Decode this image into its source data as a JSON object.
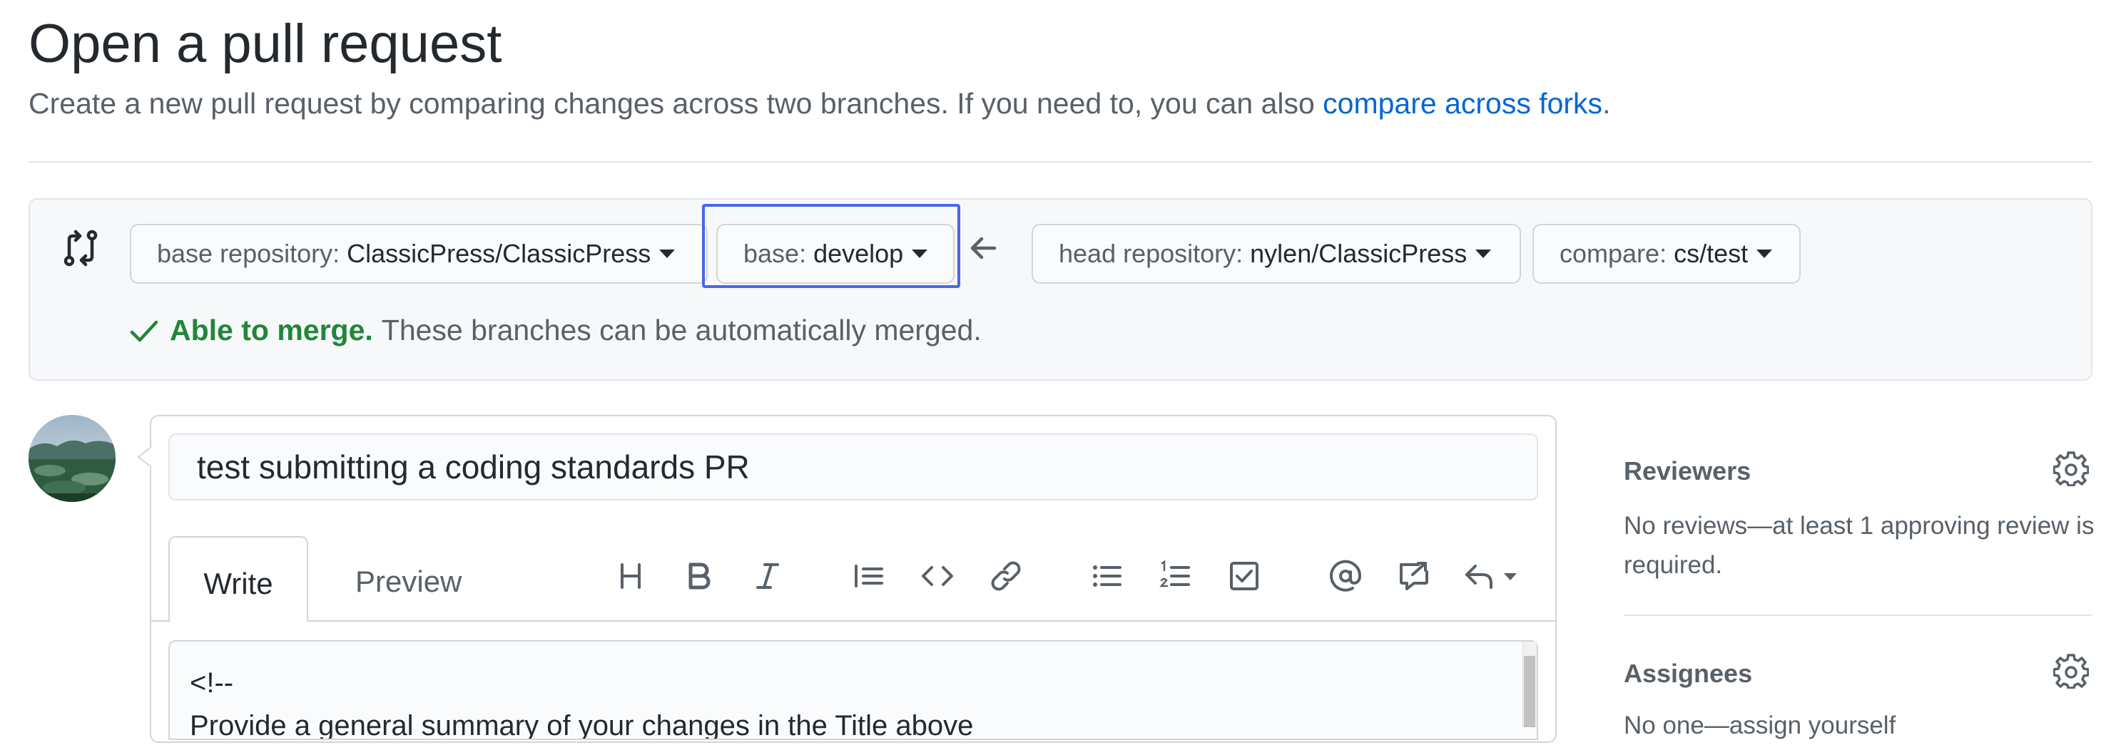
{
  "header": {
    "title": "Open a pull request",
    "subtitle_prefix": "Create a new pull request by comparing changes across two branches. If you need to, you can also ",
    "subtitle_link": "compare across forks",
    "subtitle_suffix": "."
  },
  "compare": {
    "base_repo_label": "base repository:",
    "base_repo_value": "ClassicPress/ClassicPress",
    "base_label": "base:",
    "base_value": "develop",
    "head_repo_label": "head repository:",
    "head_repo_value": "nylen/ClassicPress",
    "compare_label": "compare:",
    "compare_value": "cs/test",
    "merge_status_bold": "Able to merge.",
    "merge_status_text": "These branches can be automatically merged.",
    "highlight_color": "#4b67e4",
    "success_color": "#22863a"
  },
  "comment": {
    "title_value": "test submitting a coding standards PR",
    "tabs": [
      "Write",
      "Preview"
    ],
    "toolbar_icons": [
      "heading-icon",
      "bold-icon",
      "italic-icon",
      "quote-icon",
      "code-icon",
      "link-icon",
      "bulleted-list-icon",
      "numbered-list-icon",
      "task-list-icon",
      "mention-icon",
      "reference-icon",
      "reply-icon"
    ],
    "body_lines": [
      "<!--",
      "Provide a general summary of your changes in the Title above"
    ]
  },
  "sidebar": {
    "reviewers_heading": "Reviewers",
    "reviewers_text": "No reviews—at least 1 approving review is required.",
    "assignees_heading": "Assignees",
    "assignees_text": "No one—assign yourself"
  },
  "colors": {
    "link": "#0366d6",
    "text_muted": "#586069"
  }
}
